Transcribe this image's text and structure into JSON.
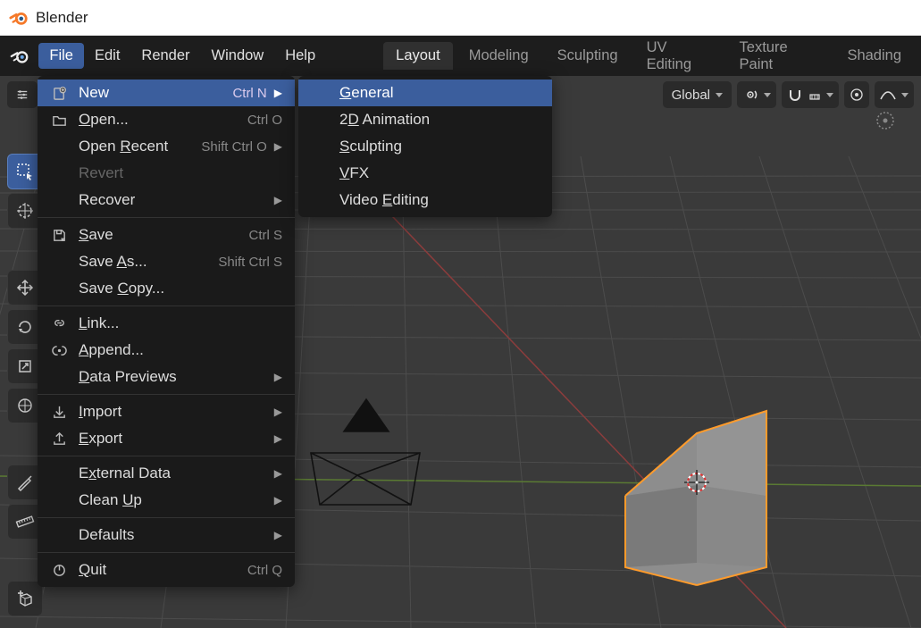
{
  "app": {
    "title": "Blender"
  },
  "menubar": [
    "File",
    "Edit",
    "Render",
    "Window",
    "Help"
  ],
  "active_menu_index": 0,
  "workspace_tabs": [
    "Layout",
    "Modeling",
    "Sculpting",
    "UV Editing",
    "Texture Paint",
    "Shading"
  ],
  "active_ws_index": 0,
  "toolbar2": {
    "pivot_icon": "crosshair",
    "orientation_label": "Global"
  },
  "file_menu": [
    {
      "icon": "new",
      "label": "New",
      "shortcut": "Ctrl N",
      "submenu": true,
      "highlight": true
    },
    {
      "icon": "open",
      "label": "Open...",
      "shortcut": "Ctrl O",
      "ul": 0
    },
    {
      "label": "Open Recent",
      "shortcut": "Shift Ctrl O",
      "submenu": true,
      "ul": 5
    },
    {
      "label": "Revert",
      "disabled": true
    },
    {
      "label": "Recover",
      "submenu": true
    },
    {
      "sep": true
    },
    {
      "icon": "save",
      "label": "Save",
      "shortcut": "Ctrl S",
      "ul": 0
    },
    {
      "label": "Save As...",
      "shortcut": "Shift Ctrl S",
      "ul": 5
    },
    {
      "label": "Save Copy...",
      "ul": 5
    },
    {
      "sep": true
    },
    {
      "icon": "link",
      "label": "Link...",
      "ul": 0
    },
    {
      "icon": "append",
      "label": "Append...",
      "ul": 0
    },
    {
      "label": "Data Previews",
      "submenu": true,
      "ul": 0
    },
    {
      "sep": true
    },
    {
      "icon": "import",
      "label": "Import",
      "submenu": true,
      "ul": 0
    },
    {
      "icon": "export",
      "label": "Export",
      "submenu": true,
      "ul": 0
    },
    {
      "sep": true
    },
    {
      "label": "External Data",
      "submenu": true,
      "ul": 1
    },
    {
      "label": "Clean Up",
      "submenu": true,
      "ul": 6
    },
    {
      "sep": true
    },
    {
      "label": "Defaults",
      "submenu": true
    },
    {
      "sep": true
    },
    {
      "icon": "quit",
      "label": "Quit",
      "shortcut": "Ctrl Q",
      "ul": 0
    }
  ],
  "new_submenu": [
    {
      "label": "General",
      "highlight": true,
      "ul": 0
    },
    {
      "label": "2D Animation",
      "ul": 1
    },
    {
      "label": "Sculpting",
      "ul": 0
    },
    {
      "label": "VFX",
      "ul": 0
    },
    {
      "label": "Video Editing",
      "ul": 6
    }
  ]
}
